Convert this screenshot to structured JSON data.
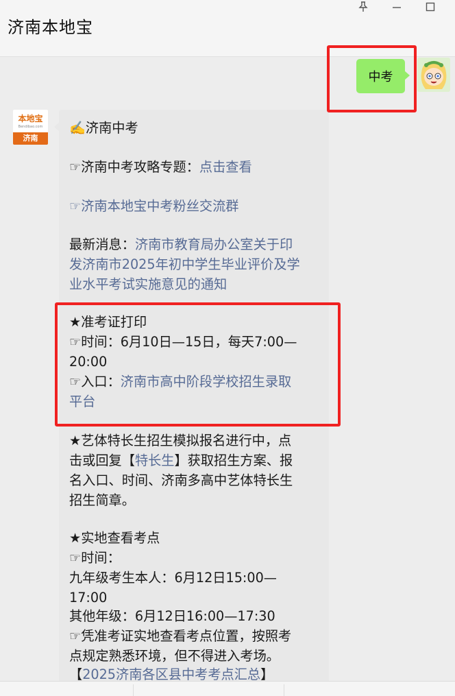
{
  "window": {
    "title": "济南本地宝",
    "controls": {
      "pin_icon": "pin-icon",
      "minimize_icon": "minimize-icon",
      "maximize_icon": "maximize-icon"
    }
  },
  "chat": {
    "user_message": "中考",
    "bot_avatar": {
      "logo_text": "本地宝",
      "domain_text": "Bendibao.com",
      "city_label": "济南"
    },
    "bot_message": {
      "heading_emoji": "✍️",
      "heading": "济南中考",
      "guide_prefix": "☞济南中考攻略专题：",
      "guide_link": "点击查看",
      "group_link": "☞济南本地宝中考粉丝交流群",
      "news_prefix": "最新消息：",
      "news_link_lines": [
        "济南市教育局办公室关于印",
        "发济南市2025年初中学生毕业评价及学",
        "业水平考试实施意见的通知"
      ],
      "admit_title": "★准考证打印",
      "admit_time_line1": "☞时间：6月10日—15日，每天7:00—",
      "admit_time_line2": "20:00",
      "admit_entry_prefix": "☞入口：",
      "admit_entry_link_line1": "济南市高中阶段学校招生录取",
      "admit_entry_link_line2": "平台",
      "art_line1": "★艺体特长生招生模拟报名进行中，点",
      "art_line2_prefix": "击或回复【",
      "art_line2_link": "特长生",
      "art_line2_suffix": "】获取招生方案、报",
      "art_line3": "名入口、时间、济南多高中艺体特长生",
      "art_line4": "招生简章。",
      "site_title": "★实地查看考点",
      "site_time": "☞时间：",
      "site_grade9_line1": "九年级考生本人：6月12日15:00—",
      "site_grade9_line2": "17:00",
      "site_other": "其他年级：6月12日16:00—17:30",
      "site_note_line1": "☞凭准考证实地查看考点位置，按照考",
      "site_note_line2": "点规定熟悉环境，但不得进入考场。",
      "site_summary_open": "【",
      "site_summary_link": "2025济南各区县中考考点汇总",
      "site_summary_close": "】"
    }
  },
  "colors": {
    "link": "#576b95",
    "user_bubble": "#95ec69",
    "bot_bubble": "#e8e8e8",
    "highlight_box": "#f02121"
  }
}
